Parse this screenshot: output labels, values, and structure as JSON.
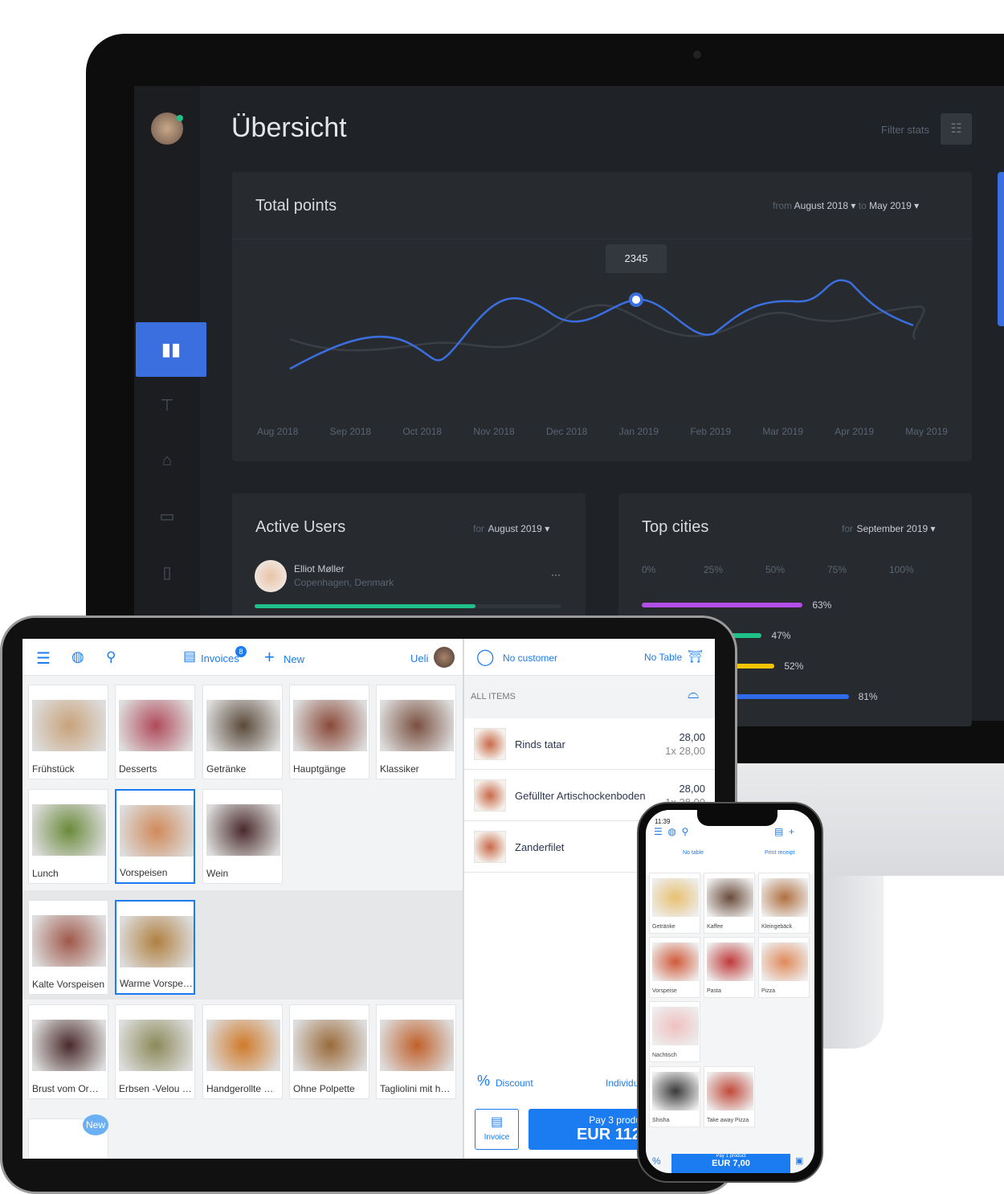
{
  "dashboard": {
    "title": "Übersicht",
    "filter_label": "Filter stats",
    "total_points": {
      "title": "Total points",
      "from_label": "from",
      "from_value": "August 2018",
      "to_label": "to",
      "to_value": "May 2019",
      "tooltip": "2345",
      "months": [
        "Aug 2018",
        "Sep 2018",
        "Oct 2018",
        "Nov 2018",
        "Dec 2018",
        "Jan 2019",
        "Feb 2019",
        "Mar 2019",
        "Apr 2019",
        "May 2019"
      ],
      "series_colors": [
        "#3b6fe0",
        "#3a3f46"
      ]
    },
    "active_users": {
      "title": "Active Users",
      "for_label": "for",
      "period": "August 2019",
      "user_name": "Elliot Møller",
      "user_location": "Copenhagen, Denmark",
      "progress": 0.72,
      "progress_color": "#20c08a"
    },
    "top_cities": {
      "title": "Top cities",
      "for_label": "for",
      "period": "September 2019",
      "ticks": [
        "0%",
        "25%",
        "50%",
        "75%",
        "100%"
      ],
      "bars": [
        {
          "value": 63,
          "label": "63%",
          "color": "#b44ee8"
        },
        {
          "value": 47,
          "label": "47%",
          "color": "#20c08a"
        },
        {
          "value": 52,
          "label": "52%",
          "color": "#f5c400"
        },
        {
          "value": 81,
          "label": "81%",
          "color": "#2f6ae8"
        }
      ]
    }
  },
  "ipad": {
    "invoices_label": "Invoices",
    "invoices_badge": "8",
    "new_label": "New",
    "user": "Ueli",
    "no_customer": "No customer",
    "no_table": "No Table",
    "all_items": "ALL ITEMS",
    "categories": [
      "Frühstück",
      "Desserts",
      "Getränke",
      "Hauptgänge",
      "Klassiker",
      "Lunch",
      "Vorspeisen",
      "Wein",
      "Kalte Vorspeisen",
      "Warme Vorspei…",
      "Brust vom Orm…",
      "Erbsen -Velou t…",
      "Handgerollte Or…",
      "Ohne Polpette",
      "Tagliolini mit ha…"
    ],
    "new_badge": "New",
    "order": [
      {
        "name": "Rinds tatar",
        "total": "28,00",
        "qty": "1x 28,00"
      },
      {
        "name": "Gefüllter Artischockenboden",
        "total": "28,00",
        "qty": "1x 28,00"
      },
      {
        "name": "Zanderfilet",
        "total": "",
        "qty": ""
      }
    ],
    "discount": "Discount",
    "individual": "Individu",
    "invoice_btn": "Invoice",
    "pay_label": "Pay 3 produ",
    "pay_amount": "EUR 112",
    "accent": "#1a7cf0"
  },
  "iphone": {
    "time": "11:39",
    "no_table": "No table",
    "print_receipt": "Print receipt",
    "categories": [
      "Getränke",
      "Kaffee",
      "Kleingebäck",
      "Vorspeise",
      "Pasta",
      "Pizza",
      "Nachtisch",
      "Shisha",
      "Take away Pizza"
    ],
    "pay_label": "Pay 1 product",
    "pay_amount": "EUR 7,00"
  }
}
